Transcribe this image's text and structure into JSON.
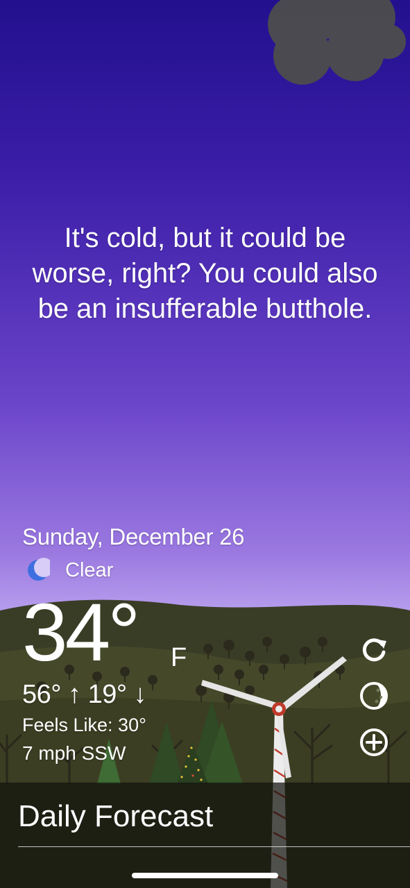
{
  "message": "It's cold, but it could be worse, right? You could also be an insufferable butthole.",
  "date": "Sunday, December 26",
  "condition": {
    "icon": "crescent-moon-icon",
    "text": "Clear"
  },
  "temperature": {
    "value": "34°",
    "unit": "F"
  },
  "hi_lo": "56° ↑ 19° ↓",
  "feels_like": "Feels Like: 30°",
  "wind": "7 mph SSW",
  "side_buttons": [
    "refresh-icon",
    "moon-phase-icon",
    "add-location-icon"
  ],
  "footer": {
    "title": "Daily Forecast"
  },
  "colors": {
    "sky_top": "#22108e",
    "sky_bottom": "#c9b6f6",
    "hill": "#3a3d25",
    "moon": "#3d6fe0"
  }
}
